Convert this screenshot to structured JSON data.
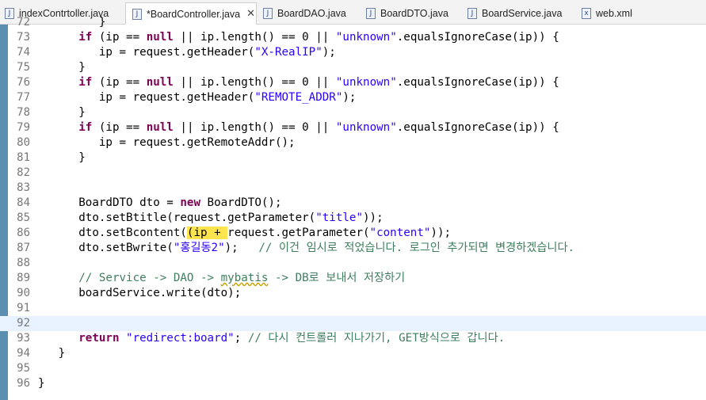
{
  "tabs": [
    {
      "label": "indexContrtoller.java",
      "icon": "J"
    },
    {
      "label": "*BoardController.java",
      "icon": "J",
      "active": true,
      "close": "✕"
    },
    {
      "label": "BoardDAO.java",
      "icon": "J"
    },
    {
      "label": "BoardDTO.java",
      "icon": "J"
    },
    {
      "label": "BoardService.java",
      "icon": "J"
    },
    {
      "label": "web.xml",
      "icon": "x"
    }
  ],
  "editor": {
    "current_line": 92,
    "lines": [
      {
        "n": 72,
        "segs": [
          {
            "t": "         }"
          }
        ]
      },
      {
        "n": 73,
        "segs": [
          {
            "t": "      "
          },
          {
            "t": "if",
            "c": "kw"
          },
          {
            "t": " (ip == "
          },
          {
            "t": "null",
            "c": "kw"
          },
          {
            "t": " || ip.length() == 0 || "
          },
          {
            "t": "\"unknown\"",
            "c": "str"
          },
          {
            "t": ".equalsIgnoreCase(ip)) {"
          }
        ]
      },
      {
        "n": 74,
        "segs": [
          {
            "t": "         ip = request.getHeader("
          },
          {
            "t": "\"X-RealIP\"",
            "c": "str"
          },
          {
            "t": ");"
          }
        ]
      },
      {
        "n": 75,
        "segs": [
          {
            "t": "      }"
          }
        ]
      },
      {
        "n": 76,
        "segs": [
          {
            "t": "      "
          },
          {
            "t": "if",
            "c": "kw"
          },
          {
            "t": " (ip == "
          },
          {
            "t": "null",
            "c": "kw"
          },
          {
            "t": " || ip.length() == 0 || "
          },
          {
            "t": "\"unknown\"",
            "c": "str"
          },
          {
            "t": ".equalsIgnoreCase(ip)) {"
          }
        ]
      },
      {
        "n": 77,
        "segs": [
          {
            "t": "         ip = request.getHeader("
          },
          {
            "t": "\"REMOTE_ADDR\"",
            "c": "str"
          },
          {
            "t": ");"
          }
        ]
      },
      {
        "n": 78,
        "segs": [
          {
            "t": "      }"
          }
        ]
      },
      {
        "n": 79,
        "segs": [
          {
            "t": "      "
          },
          {
            "t": "if",
            "c": "kw"
          },
          {
            "t": " (ip == "
          },
          {
            "t": "null",
            "c": "kw"
          },
          {
            "t": " || ip.length() == 0 || "
          },
          {
            "t": "\"unknown\"",
            "c": "str"
          },
          {
            "t": ".equalsIgnoreCase(ip)) {"
          }
        ]
      },
      {
        "n": 80,
        "segs": [
          {
            "t": "         ip = request.getRemoteAddr();"
          }
        ]
      },
      {
        "n": 81,
        "segs": [
          {
            "t": "      }"
          }
        ]
      },
      {
        "n": 82,
        "segs": [
          {
            "t": ""
          }
        ]
      },
      {
        "n": 83,
        "segs": [
          {
            "t": ""
          }
        ]
      },
      {
        "n": 84,
        "segs": [
          {
            "t": "      BoardDTO dto = "
          },
          {
            "t": "new",
            "c": "kw"
          },
          {
            "t": " BoardDTO();"
          }
        ]
      },
      {
        "n": 85,
        "segs": [
          {
            "t": "      dto.setBtitle(request.getParameter("
          },
          {
            "t": "\"title\"",
            "c": "str"
          },
          {
            "t": "));"
          }
        ]
      },
      {
        "n": 86,
        "segs": [
          {
            "t": "      dto.setBcontent("
          },
          {
            "t": "(ip + ",
            "c": "hl"
          },
          {
            "t": "request.getParameter("
          },
          {
            "t": "\"content\"",
            "c": "str"
          },
          {
            "t": "));"
          }
        ]
      },
      {
        "n": 87,
        "segs": [
          {
            "t": "      dto.setBwrite("
          },
          {
            "t": "\"홍길동2\"",
            "c": "str"
          },
          {
            "t": ");   "
          },
          {
            "t": "// 이건 임시로 적었습니다. 로그인 추가되면 변경하겠습니다.",
            "c": "cmt"
          }
        ]
      },
      {
        "n": 88,
        "segs": [
          {
            "t": ""
          }
        ]
      },
      {
        "n": 89,
        "segs": [
          {
            "t": "      // Service -> DAO -> ",
            "c": "cmt"
          },
          {
            "t": "mybatis",
            "c": "cmt sq"
          },
          {
            "t": " -> DB로 보내서 저장하기",
            "c": "cmt"
          }
        ]
      },
      {
        "n": 90,
        "segs": [
          {
            "t": "      boardService.write(dto);"
          }
        ]
      },
      {
        "n": 91,
        "segs": [
          {
            "t": ""
          }
        ]
      },
      {
        "n": 92,
        "segs": [
          {
            "t": ""
          }
        ]
      },
      {
        "n": 93,
        "segs": [
          {
            "t": "      "
          },
          {
            "t": "return",
            "c": "kw"
          },
          {
            "t": " "
          },
          {
            "t": "\"redirect:board\"",
            "c": "str"
          },
          {
            "t": "; "
          },
          {
            "t": "// 다시 컨트롤러 지나가기, GET방식으로 갑니다.",
            "c": "cmt"
          }
        ]
      },
      {
        "n": 94,
        "segs": [
          {
            "t": "   }"
          }
        ]
      },
      {
        "n": 95,
        "segs": [
          {
            "t": ""
          }
        ]
      },
      {
        "n": 96,
        "segs": [
          {
            "t": "}"
          }
        ]
      }
    ]
  }
}
